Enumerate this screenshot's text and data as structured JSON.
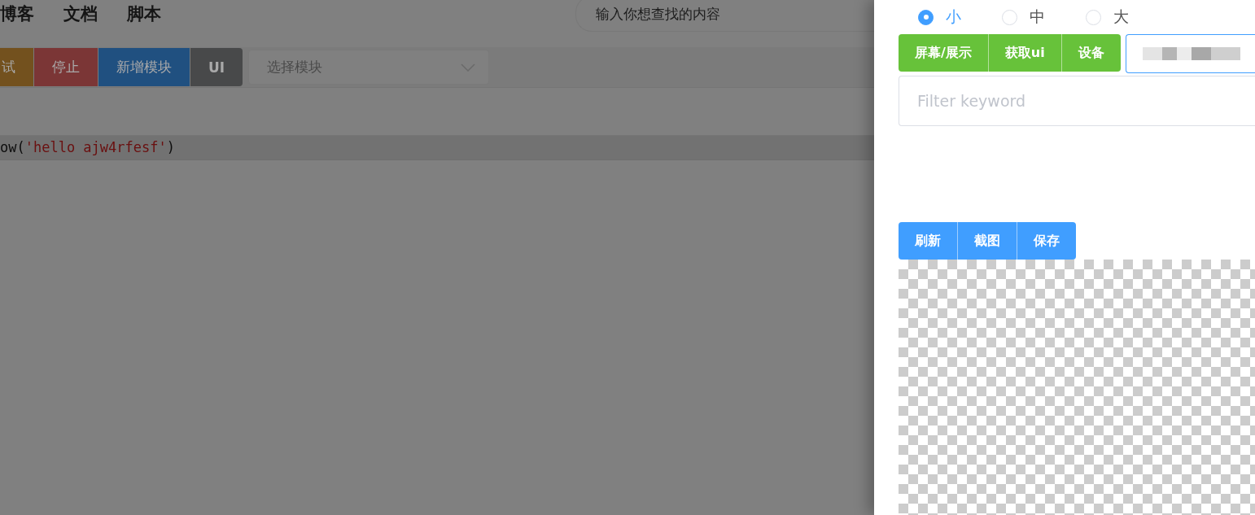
{
  "nav": {
    "items": [
      {
        "label": "博客"
      },
      {
        "label": "文档"
      },
      {
        "label": "脚本"
      }
    ],
    "search": {
      "placeholder": "输入你想查找的内容"
    }
  },
  "toolbar": {
    "buttons": [
      {
        "label": "试",
        "kind": "warning"
      },
      {
        "label": "停止",
        "kind": "danger"
      },
      {
        "label": "新增模块",
        "kind": "primary"
      },
      {
        "label": "UI",
        "kind": "info"
      }
    ],
    "module_select": {
      "placeholder": "选择模块"
    }
  },
  "editor": {
    "lines": [
      {
        "parts": [
          {
            "text": "ow(",
            "kind": "plain"
          },
          {
            "text": "'hello ajw4rfesf'",
            "kind": "string"
          },
          {
            "text": ")",
            "kind": "plain"
          }
        ],
        "highlighted": true
      }
    ]
  },
  "drawer": {
    "size_options": [
      {
        "label": "小",
        "selected": true
      },
      {
        "label": "中",
        "selected": false
      },
      {
        "label": "大",
        "selected": false
      }
    ],
    "device_buttons": [
      {
        "label": "屏幕/展示"
      },
      {
        "label": "获取ui"
      },
      {
        "label": "设备"
      }
    ],
    "device_field": {
      "focused": true
    },
    "filter": {
      "placeholder": "Filter keyword"
    },
    "screen_buttons": [
      {
        "label": "刷新"
      },
      {
        "label": "截图"
      },
      {
        "label": "保存"
      }
    ]
  }
}
